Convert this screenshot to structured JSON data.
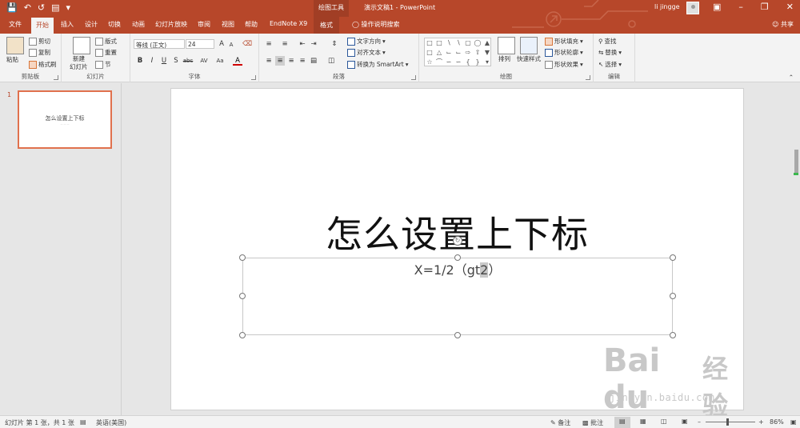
{
  "titlebar": {
    "context_tools": "绘图工具",
    "doc_title": "演示文稿1  -  PowerPoint",
    "user_name": "li jingge",
    "qat": [
      "save-icon",
      "undo-icon",
      "redo-icon",
      "present-icon"
    ]
  },
  "tabs": [
    "文件",
    "开始",
    "插入",
    "设计",
    "切换",
    "动画",
    "幻灯片放映",
    "审阅",
    "视图",
    "帮助",
    "EndNote X9",
    "格式"
  ],
  "active_tab": "开始",
  "tell_me": "操作说明搜索",
  "share": "共享",
  "ribbon": {
    "clipboard": {
      "paste": "粘贴",
      "cut": "剪切",
      "copy": "复制",
      "format_painter": "格式刷",
      "label": "剪贴板"
    },
    "slides": {
      "new_slide": "新建",
      "new_slide2": "幻灯片",
      "layout": "版式",
      "reset": "重置",
      "section": "节",
      "label": "幻灯片"
    },
    "font": {
      "name": "等线 (正文)",
      "size": "24",
      "label": "字体",
      "bold": "B",
      "italic": "I",
      "underline": "U",
      "shadow": "S",
      "strike": "abc",
      "spacing": "AV",
      "case": "Aa",
      "color": "A",
      "grow": "A",
      "shrink": "A"
    },
    "paragraph": {
      "text_direction": "文字方向",
      "align_text": "对齐文本",
      "smartart": "转换为 SmartArt",
      "label": "段落"
    },
    "drawing": {
      "arrange": "排列",
      "quick_styles": "快速样式",
      "shape_fill": "形状填充",
      "shape_outline": "形状轮廓",
      "shape_effects": "形状效果",
      "label": "绘图"
    },
    "editing": {
      "find": "查找",
      "replace": "替换",
      "select": "选择",
      "label": "编辑"
    }
  },
  "thumbnails": [
    {
      "number": "1",
      "title": "怎么设置上下标"
    }
  ],
  "slide": {
    "title": "怎么设置上下标",
    "subtitle_pre": "X=1/2（gt",
    "subtitle_sel": "2",
    "subtitle_post": "）"
  },
  "watermark": {
    "logo": "Bai du",
    "cn": "经验",
    "url": "jingyan.baidu.com"
  },
  "statusbar": {
    "slide_info": "幻灯片 第 1 张，共 1 张",
    "language": "英语(美国)",
    "notes": "备注",
    "comments": "批注",
    "zoom": "86%",
    "zoom_fraction": 0.43
  },
  "colors": {
    "accent": "#b7472a",
    "thumb_border": "#e0714d"
  }
}
